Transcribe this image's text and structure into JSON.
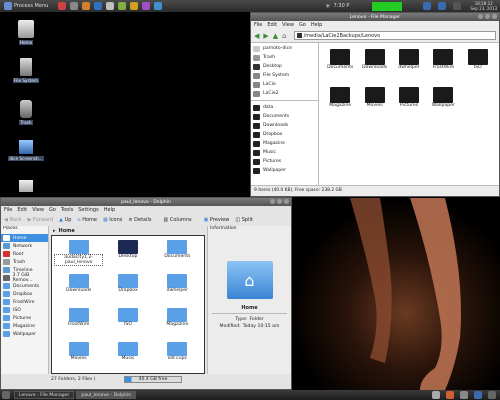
{
  "top_panel": {
    "process_menu": "Process Menu",
    "clock_small": "7:30 P",
    "clock_time": "18:28:12",
    "clock_date": "Sep 23, 2013"
  },
  "desktop_icons": [
    {
      "label": "Home"
    },
    {
      "label": "File System"
    },
    {
      "label": "Trash"
    },
    {
      "label": "dice Screensh..."
    }
  ],
  "file_manager": {
    "title": "Lenovo - File Manager",
    "menu": [
      "File",
      "Edit",
      "View",
      "Go",
      "Help"
    ],
    "path": "/media/LaCie2Backups/Lenovo",
    "sidebar": [
      "pamoto-dice",
      "Trash",
      "Desktop",
      "File System",
      "LaCie",
      "LaCie2",
      "data",
      "Documents",
      "Downloads",
      "Dropbox",
      "Magazine",
      "Music",
      "Pictures",
      "Wallpaper"
    ],
    "items": [
      "Documents",
      "Downloads",
      "dwhelper",
      "FrostWire",
      "ISO",
      "Magazine",
      "Movies",
      "Pictures",
      "Wallpaper"
    ],
    "status": "9 items (40.0 KB), Free space: 238.2 GB"
  },
  "dolphin": {
    "title": "paul_lenovo - Dolphin",
    "menu": [
      "File",
      "Edit",
      "View",
      "Go",
      "Tools",
      "Settings",
      "Help"
    ],
    "toolbar": [
      "Back",
      "Forward",
      "Up",
      "Home",
      "Icons",
      "Details",
      "Columns",
      "Preview",
      "Split"
    ],
    "places_header": "Places",
    "places": [
      "Home",
      "Network",
      "Root",
      "Trash",
      "Timeline",
      "3.7 GiB Remov...",
      "Documents",
      "Dropbox",
      "FrostWire",
      "ISO",
      "Pictures",
      "Magazine",
      "Wallpaper"
    ],
    "breadcrumb": "Home",
    "items": [
      "audacity1.2-paul_lenovo",
      "Desktop",
      "Documents",
      "Downloads",
      "Dropbox",
      "dwhelper",
      "FrostWire",
      "ISO",
      "Magazine",
      "Movies",
      "Music",
      "old cups"
    ],
    "info_header": "Information",
    "info_name": "Home",
    "info_type_label": "Type:",
    "info_type_value": "Folder",
    "info_modified_label": "Modified:",
    "info_modified_value": "Today 10:15 am",
    "status": "27 Folders, 2 Files (",
    "free": "40.4 GB free"
  },
  "taskbar": {
    "tasks": [
      "Lenovo - File Manager",
      "paul_lenovo - Dolphin"
    ]
  },
  "colors": {
    "folder_dark": "#1a1a1a",
    "folder_blue": "#5aa0e6",
    "selection": "#3d8fe0",
    "cpu_meter": "#22cc22"
  }
}
